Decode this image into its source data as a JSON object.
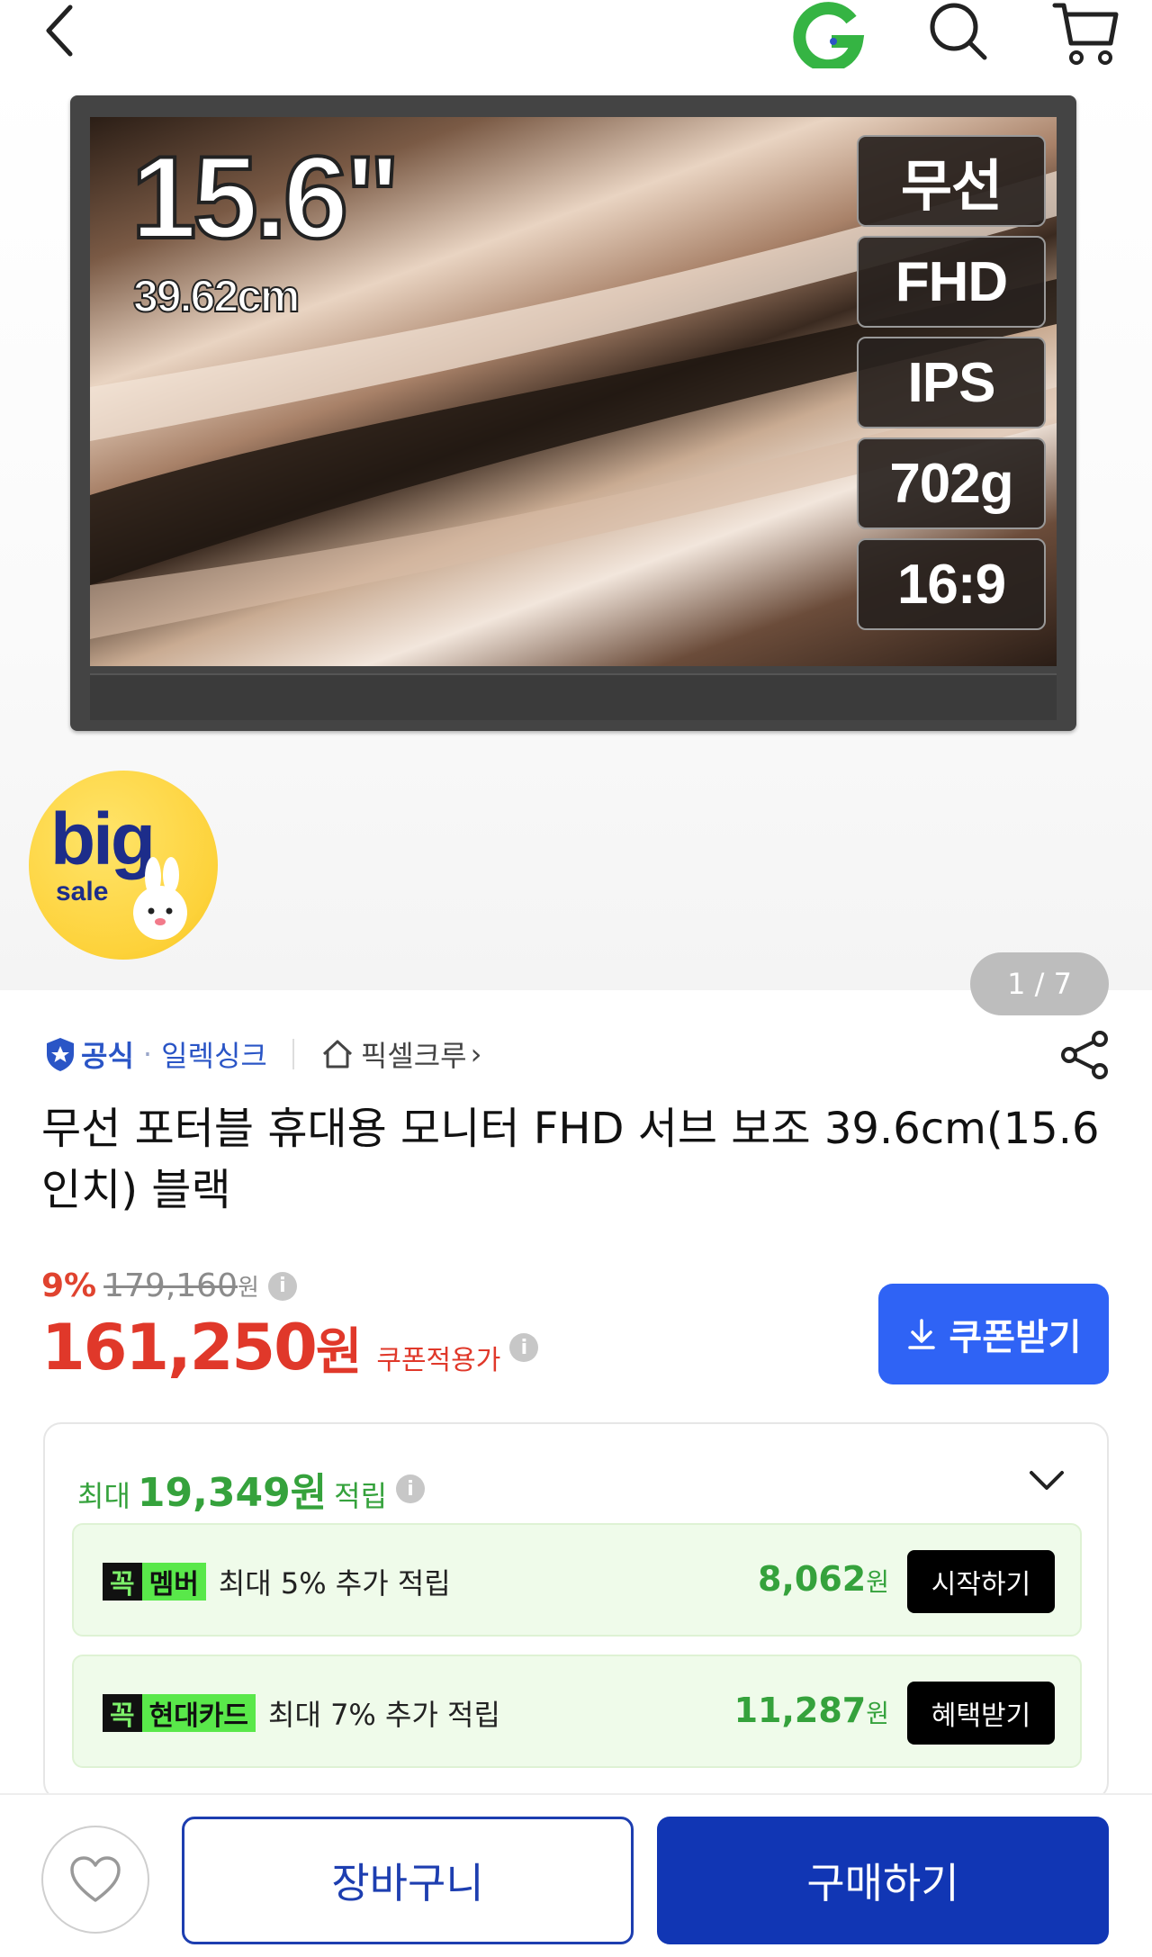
{
  "header": {
    "icons": [
      "back-arrow-icon",
      "g-logo-icon",
      "search-icon",
      "cart-icon"
    ],
    "logo_color": "#35b443"
  },
  "gallery": {
    "image": {
      "size_inch": "15.6\"",
      "size_cm": "39.62cm",
      "specs": [
        "무선",
        "FHD",
        "IPS",
        "702g",
        "16:9"
      ]
    },
    "big_sale": {
      "big": "big",
      "sale": "sale"
    },
    "counter": "1 / 7"
  },
  "seller": {
    "official": "공식",
    "brand": "일렉싱크",
    "shop": "픽셀크루",
    "chevron": "›"
  },
  "product": {
    "title": "무선 포터블 휴대용 모니터 FHD 서브 보조 39.6cm(15.6인치) 블랙"
  },
  "pricing": {
    "discount": "9%",
    "original": "179,160",
    "original_unit": "원",
    "price": "161,250",
    "price_unit": "원",
    "coupon_label": "쿠폰적용가",
    "coupon_button": "쿠폰받기",
    "price_color": "#e0382a",
    "coupon_button_color": "#2f63f5"
  },
  "points": {
    "prefix": "최대",
    "amount": "19,349원",
    "suffix": "적립",
    "items": [
      {
        "badge_icon": "꼭",
        "badge_text": "멤버",
        "desc": "최대 5% 추가 적립",
        "amount": "8,062",
        "unit": "원",
        "button": "시작하기"
      },
      {
        "badge_icon": "꼭",
        "badge_text": "현대카드",
        "desc": "최대 7% 추가 적립",
        "amount": "11,287",
        "unit": "원",
        "button": "혜택받기"
      }
    ],
    "accent_color": "#35a23c"
  },
  "bottom_bar": {
    "cart": "장바구니",
    "buy": "구매하기",
    "buy_color": "#1136b4"
  }
}
